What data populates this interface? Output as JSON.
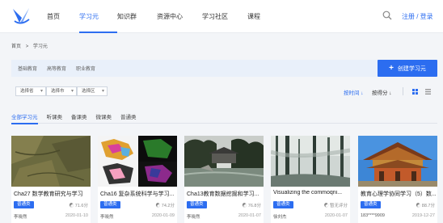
{
  "nav": {
    "items": [
      "首页",
      "学习元",
      "知识群",
      "资源中心",
      "学习社区",
      "课程"
    ],
    "active_index": 1,
    "auth_label": "注册 / 登录"
  },
  "breadcrumb": [
    "首页",
    ">",
    "学习元"
  ],
  "filters": [
    "基础教育",
    "高等教育",
    "职业教育"
  ],
  "create_button": {
    "icon": "plus-icon",
    "label": "创建学习元"
  },
  "selects": [
    "选择省",
    "选择市",
    "选择区"
  ],
  "sort": {
    "by_time": "按时间 ↓",
    "by_rank": "按得分 ↓"
  },
  "tabs": [
    "全部学习元",
    "听课类",
    "备课类",
    "微课类",
    "普通类"
  ],
  "active_tab": 0,
  "cards": [
    {
      "title": "Cha27 数学教育研究与学习",
      "badge": "普通类",
      "score": "71.6分",
      "author": "李晓然",
      "date": "2020-01-10",
      "image": "rocky-terrain"
    },
    {
      "title": "Cha16 复杂系统科学与学习...",
      "badge": "普通类",
      "score": "74.2分",
      "author": "李晓然",
      "date": "2020-01-09",
      "image": "maps"
    },
    {
      "title": "Cha13教育数据挖掘和学习...",
      "badge": "普通类",
      "score": "76.8分",
      "author": "李晓然",
      "date": "2020-01-07",
      "image": "garden"
    },
    {
      "title": "Visualizing the commoqni...",
      "badge": "普通类",
      "score": "暂无评分",
      "author": "徐刘杰",
      "date": "2020-01-07",
      "image": "forest"
    },
    {
      "title": "教育心理学协同学习（5）数...",
      "badge": "普通类",
      "score": "88.7分",
      "author": "183****9909",
      "date": "2019-12-27",
      "image": "pagoda"
    }
  ],
  "colors": {
    "accent": "#2c6df0",
    "badge": "#2c6df0",
    "filterbar": "#e9f0fa"
  }
}
